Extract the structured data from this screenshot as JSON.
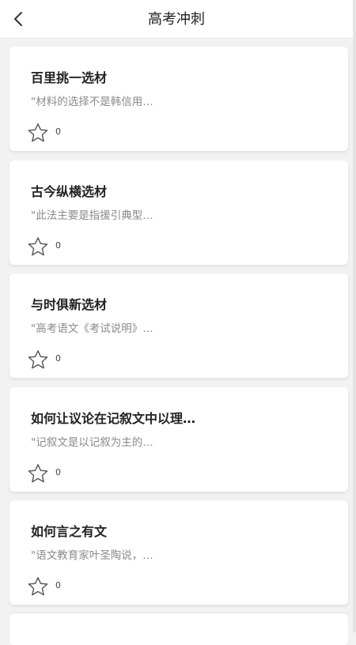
{
  "header": {
    "title": "高考冲刺",
    "back_icon": "chevron-left-icon"
  },
  "cards": [
    {
      "title": "百里挑一选材",
      "excerpt": "\"材料的选择不是韩信用…",
      "likes": "0",
      "icon": "star-outline-icon"
    },
    {
      "title": "古今纵横选材",
      "excerpt": "\"此法主要是指援引典型…",
      "likes": "0",
      "icon": "star-outline-icon"
    },
    {
      "title": "与时俱新选材",
      "excerpt": "\"高考语文《考试说明》…",
      "likes": "0",
      "icon": "star-outline-icon"
    },
    {
      "title": "如何让议论在记叙文中以理…",
      "excerpt": "\"记叙文是以记叙为主的…",
      "likes": "0",
      "icon": "star-outline-icon"
    },
    {
      "title": "如何言之有文",
      "excerpt": "\"语文教育家叶圣陶说，…",
      "likes": "0",
      "icon": "star-outline-icon"
    }
  ],
  "colors": {
    "background": "#f2f2f2",
    "card": "#ffffff",
    "title": "#222222",
    "excerpt": "#8a8a8a"
  }
}
